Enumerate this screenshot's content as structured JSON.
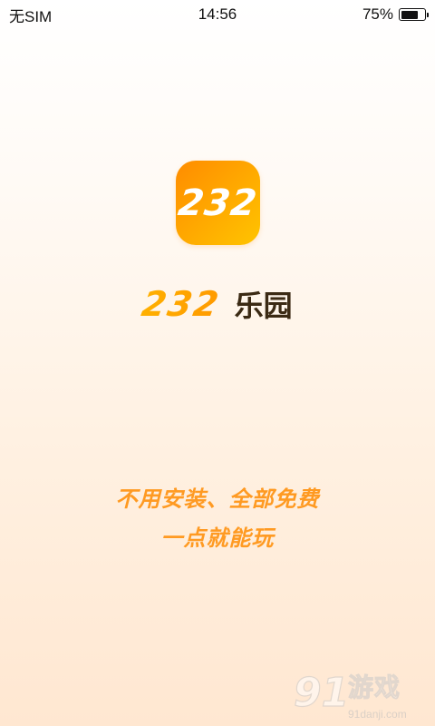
{
  "status_bar": {
    "carrier": "无SIM",
    "time": "14:56",
    "battery_percent_label": "75%",
    "battery_level": 0.75
  },
  "app_icon": {
    "text": "232",
    "gradient_start": "#ff8c00",
    "gradient_end": "#ffc400"
  },
  "brand": {
    "number": "232",
    "name": "乐园",
    "number_color": "#ffa800",
    "name_color": "#3b2a14"
  },
  "slogan": {
    "line1": "不用安装、全部免费",
    "line2": "一点就能玩",
    "color": "#ff9a22"
  },
  "watermark": {
    "logo": "91",
    "name": "游戏",
    "domain": "91danji.com"
  }
}
